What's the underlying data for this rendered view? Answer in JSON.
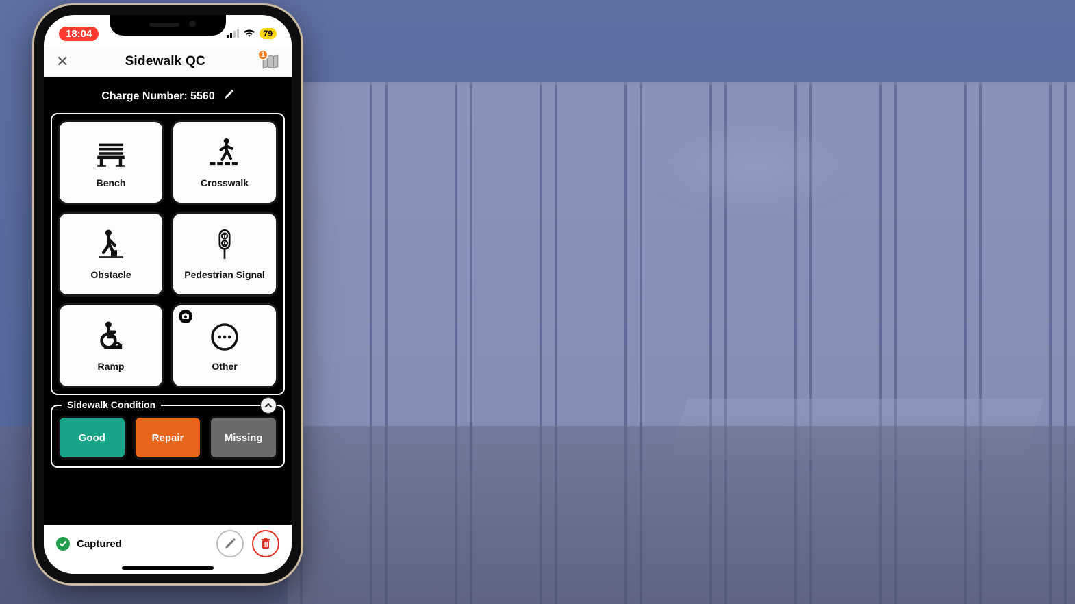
{
  "status": {
    "time": "18:04",
    "battery": "79"
  },
  "header": {
    "title": "Sidewalk QC",
    "map_badge": "1"
  },
  "charge": {
    "label": "Charge Number: 5560"
  },
  "tiles": [
    {
      "label": "Bench",
      "icon": "bench-icon",
      "camera": false
    },
    {
      "label": "Crosswalk",
      "icon": "crosswalk-icon",
      "camera": false
    },
    {
      "label": "Obstacle",
      "icon": "obstacle-icon",
      "camera": false
    },
    {
      "label": "Pedestrian Signal",
      "icon": "pedestrian-signal-icon",
      "camera": false
    },
    {
      "label": "Ramp",
      "icon": "ramp-icon",
      "camera": false
    },
    {
      "label": "Other",
      "icon": "other-icon",
      "camera": true
    }
  ],
  "condition": {
    "title": "Sidewalk Condition",
    "options": [
      {
        "label": "Good",
        "color": "#17a589"
      },
      {
        "label": "Repair",
        "color": "#e8651a"
      },
      {
        "label": "Missing",
        "color": "#6b6b6b"
      }
    ]
  },
  "footer": {
    "captured_label": "Captured"
  }
}
